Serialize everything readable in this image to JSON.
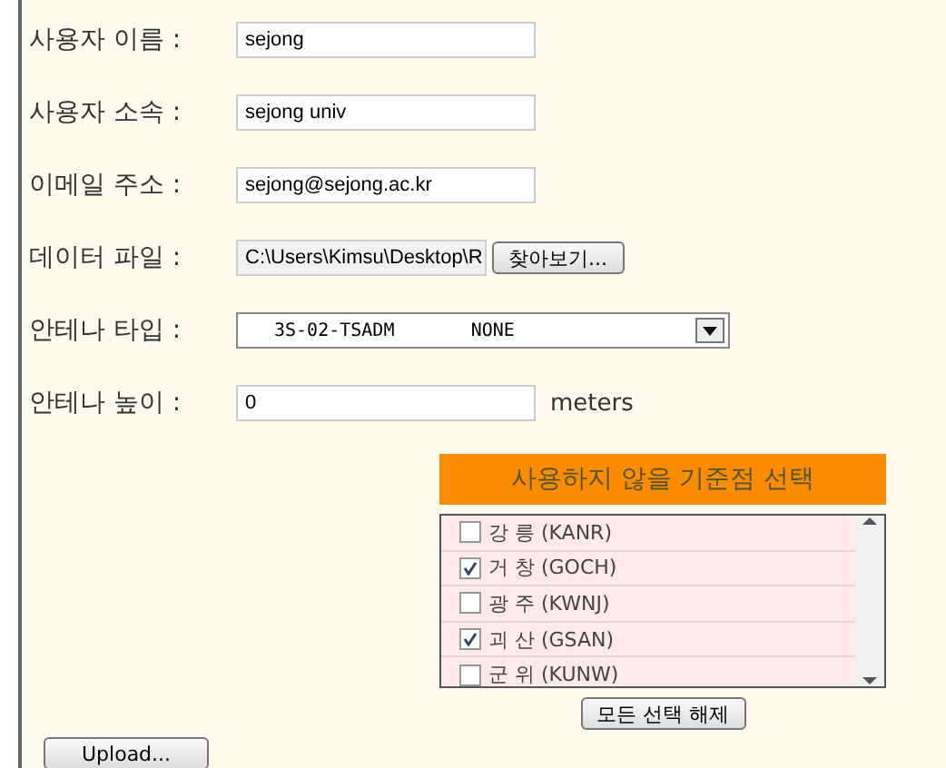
{
  "fields": [
    {
      "label": "사용자 이름 :",
      "value": "sejong"
    },
    {
      "label": "사용자 소속 :",
      "value": "sejong univ"
    },
    {
      "label": "이메일 주소 :",
      "value": "sejong@sejong.ac.kr"
    }
  ],
  "data_file": {
    "label": "데이터 파일 :",
    "value": "C:\\Users\\Kimsu\\Desktop\\R",
    "button": "찾아보기..."
  },
  "antenna_type": {
    "label": "안테나 타입 :",
    "value": "3S-02-TSADM       NONE"
  },
  "antenna_height": {
    "label": "안테나 높이 :",
    "value": "0",
    "unit": "meters"
  },
  "stations": {
    "title": "사용하지 않을 기준점 선택",
    "items": [
      {
        "label": "강 릉 (KANR)",
        "checked": false
      },
      {
        "label": "거 창 (GOCH)",
        "checked": true
      },
      {
        "label": "광 주 (KWNJ)",
        "checked": false
      },
      {
        "label": "괴 산 (GSAN)",
        "checked": true
      },
      {
        "label": "군 위 (KUNW)",
        "checked": false
      }
    ],
    "clear_button": "모든 선택 해제"
  },
  "upload_button": "Upload..."
}
